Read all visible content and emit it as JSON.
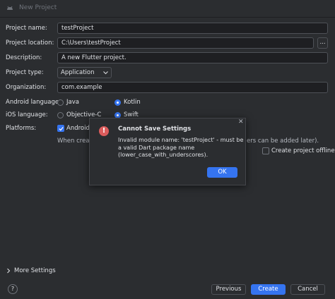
{
  "window": {
    "title": "New Project"
  },
  "form": {
    "project_name_label": "Project name:",
    "project_name_value": "testProject",
    "project_location_label": "Project location:",
    "project_location_value": "C:\\Users\\testProject",
    "browse_label": "...",
    "description_label": "Description:",
    "description_value": "A new Flutter project.",
    "project_type_label": "Project type:",
    "project_type_value": "Application",
    "organization_label": "Organization:",
    "organization_value": "com.example",
    "android_language_label": "Android language:",
    "android_options": [
      "Java",
      "Kotlin"
    ],
    "android_selected": "Kotlin",
    "ios_language_label": "iOS language:",
    "ios_options": [
      "Objective-C",
      "Swift"
    ],
    "ios_selected": "Swift",
    "platforms_label": "Platforms:",
    "platform_android": "Android",
    "platforms_note_start": "When creat",
    "platforms_note_end": "ers can be added later).",
    "create_offline_label": "Create project offline"
  },
  "more_settings": "More Settings",
  "footer": {
    "help": "?",
    "previous": "Previous",
    "create": "Create",
    "cancel": "Cancel"
  },
  "dialog": {
    "title": "Cannot Save Settings",
    "message_line1": "Invalid module name: 'testProject' - must be",
    "message_line2": "a valid Dart package name",
    "message_line3": "(lower_case_with_underscores).",
    "ok": "OK",
    "close": "✕",
    "error_glyph": "!"
  },
  "colors": {
    "accent": "#3574f0",
    "error": "#db5c5c",
    "background": "#2b2d30"
  }
}
